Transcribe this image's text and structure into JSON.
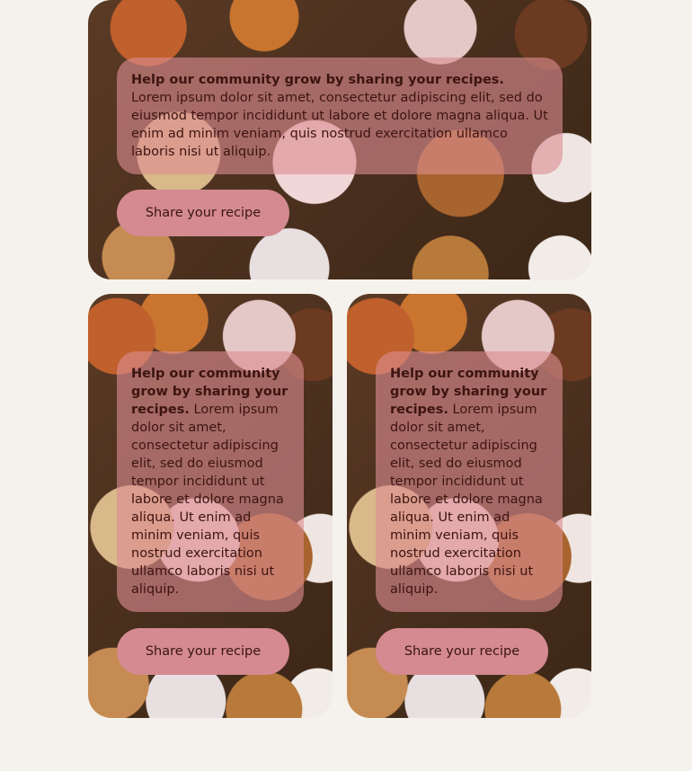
{
  "cards": [
    {
      "heading": "Help our community grow by sharing your recipes.",
      "body": " Lorem ipsum dolor sit amet, consectetur adipiscing elit, sed do eiusmod tempor incididunt ut labore et dolore magna aliqua. Ut enim ad minim veniam, quis nostrud exercitation ullamco laboris nisi ut aliquip.",
      "button_label": "Share your recipe"
    },
    {
      "heading": "Help our community grow by sharing your recipes.",
      "body": " Lorem ipsum dolor sit amet, consectetur adipiscing elit, sed do eiusmod tempor incididunt ut labore et dolore magna aliqua. Ut enim ad minim veniam, quis nostrud exercitation ullamco laboris nisi ut aliquip.",
      "button_label": "Share your recipe"
    },
    {
      "heading": "Help our community grow by sharing your recipes.",
      "body": " Lorem ipsum dolor sit amet, consectetur adipiscing elit, sed do eiusmod tempor incididunt ut labore et dolore magna aliqua. Ut enim ad minim veniam, quis nostrud exercitation ullamco laboris nisi ut aliquip.",
      "button_label": "Share your recipe"
    }
  ],
  "colors": {
    "page_background": "#f5f2ed",
    "text_box_tint": "#dc8c91",
    "button": "#d48a90",
    "text": "#3d1410"
  }
}
